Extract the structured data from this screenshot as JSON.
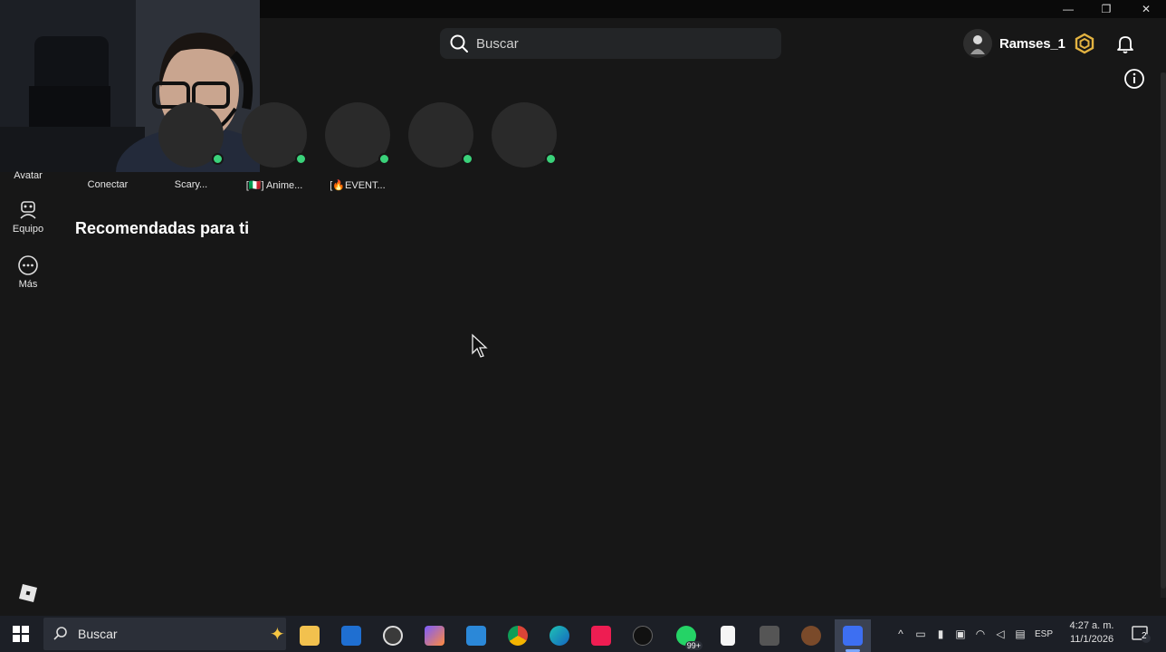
{
  "window": {
    "minimize": "—",
    "maximize": "❐",
    "close": "✕"
  },
  "header": {
    "search_placeholder": "Buscar",
    "username": "Ramses_1"
  },
  "sidebar": {
    "items": [
      {
        "label": "Avatar",
        "icon": "avatar-icon"
      },
      {
        "label": "Equipo",
        "icon": "team-icon"
      },
      {
        "label": "Más",
        "icon": "more-icon"
      }
    ]
  },
  "friends": {
    "connect_label": "Conectar",
    "items": [
      {
        "label": "Scary..."
      },
      {
        "label": "[🇮🇹] Anime..."
      },
      {
        "label": "[🔥EVENT..."
      },
      {
        "label": ""
      },
      {
        "label": ""
      }
    ]
  },
  "main": {
    "section_title": "Recomendadas para ti"
  },
  "taskbar": {
    "search_label": "Buscar",
    "whatsapp_badge": "99+",
    "language": "ESP",
    "time": "4:27 a. m.",
    "date": "11/1/2026",
    "notifications_count": "2"
  },
  "colors": {
    "background": "#171717",
    "online": "#3ad27a",
    "taskbar": "#1c1f26"
  }
}
